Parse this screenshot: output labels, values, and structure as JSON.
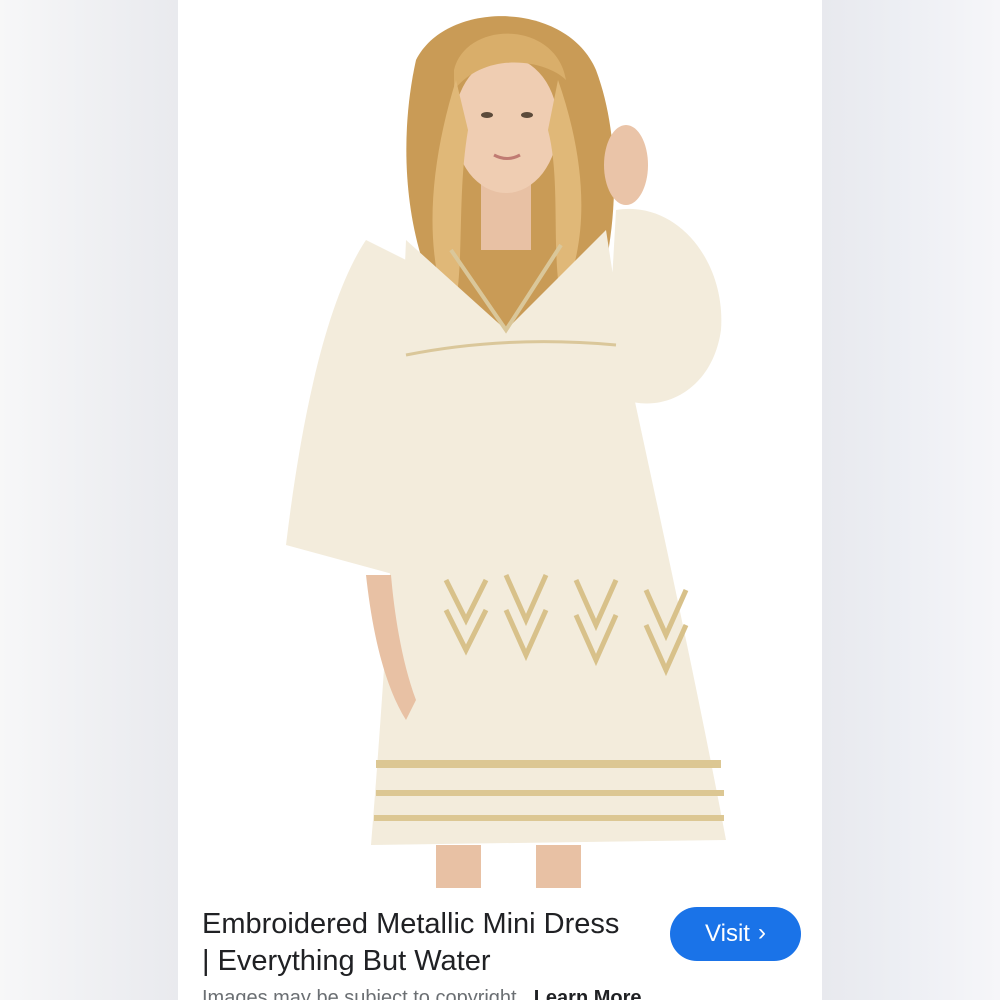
{
  "result": {
    "title": "Embroidered Metallic Mini Dress | Everything But Water",
    "visit_label": "Visit",
    "visit_icon": "chevron-right-icon",
    "caption": "Images may be subject to copyright.",
    "learn_more": "Learn More"
  },
  "colors": {
    "accent": "#1a73e8",
    "dress": "#f3ecdc",
    "embroidery": "#d8c18a"
  }
}
